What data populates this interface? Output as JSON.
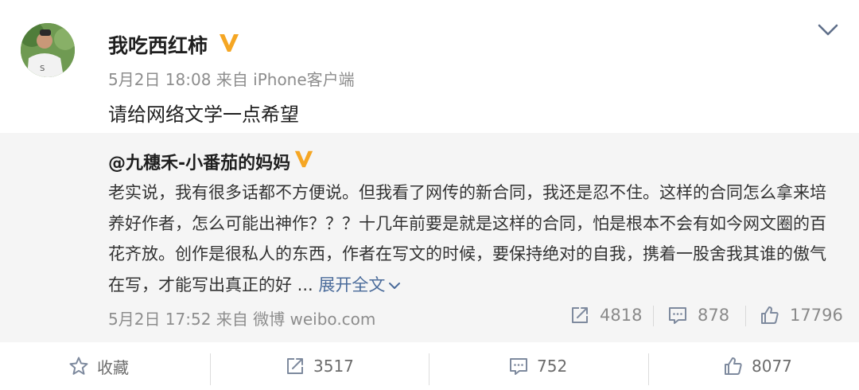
{
  "post": {
    "username": "我吃西红柿",
    "meta": "5月2日 18:08 来自 iPhone客户端",
    "text": "请给网络文学一点希望"
  },
  "repost": {
    "author": "@九穗禾-小番茄的妈妈",
    "text": "老实说，我有很多话都不方便说。但我看了网传的新合同，我还是忍不住。这样的合同怎么拿来培养好作者，怎么可能出神作？？？十几年前要是就是这样的合同，怕是根本不会有如今网文圈的百花齐放。创作是很私人的东西，作者在写文的时候，要保持绝对的自我，携着一股舍我其谁的傲气在写，才能写出真正的好 ...",
    "expand_label": "展开全文",
    "meta": "5月2日 17:52 来自 微博 weibo.com",
    "reposts": "4818",
    "comments": "878",
    "likes": "17796"
  },
  "toolbar": {
    "favorite_label": "收藏",
    "reposts": "3517",
    "comments": "752",
    "likes": "8077"
  },
  "colors": {
    "verified_badge": "#f5a623",
    "link": "#4a6b9a",
    "repost_bg": "#f5f5f5"
  }
}
